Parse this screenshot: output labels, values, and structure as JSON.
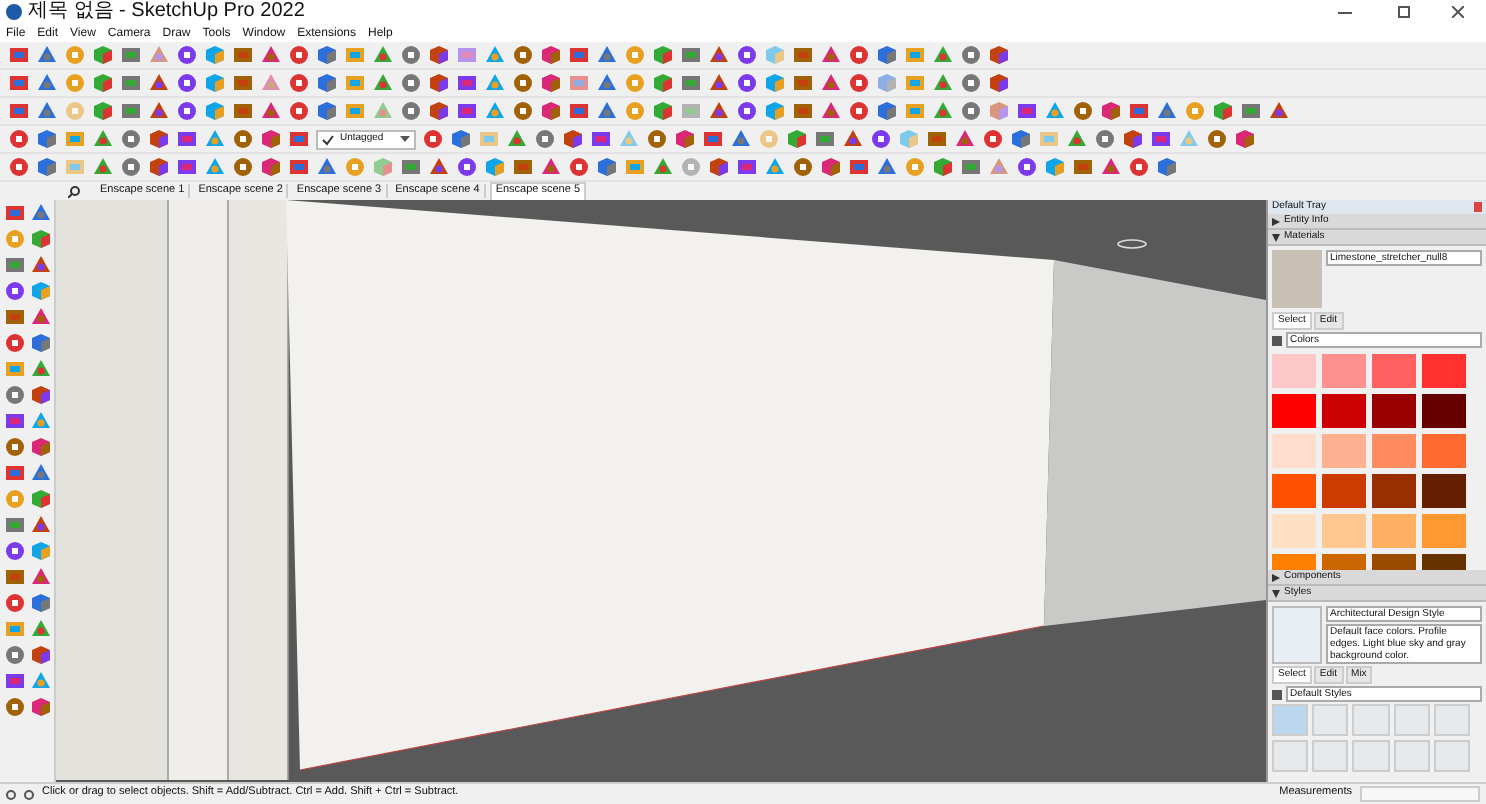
{
  "window": {
    "title": "제목 없음 - SketchUp Pro 2022"
  },
  "menu": [
    "File",
    "Edit",
    "View",
    "Camera",
    "Draw",
    "Tools",
    "Window",
    "Extensions",
    "Help"
  ],
  "tag_dropdown": {
    "value": "Untagged"
  },
  "scene_tabs": [
    {
      "label": "Enscape scene 1",
      "selected": false
    },
    {
      "label": "Enscape scene 2",
      "selected": false
    },
    {
      "label": "Enscape scene 3",
      "selected": false
    },
    {
      "label": "Enscape scene 4",
      "selected": false
    },
    {
      "label": "Enscape scene 5",
      "selected": true
    }
  ],
  "tray": {
    "title": "Default Tray",
    "panels": [
      {
        "kind": "collapsed",
        "title": "Entity Info"
      },
      {
        "kind": "materials",
        "title": "Materials",
        "material_name": "Limestone_stretcher_null8",
        "tabs": [
          {
            "label": "Select",
            "selected": true
          },
          {
            "label": "Edit",
            "selected": false
          }
        ],
        "library": "Colors",
        "swatches": [
          {
            "color": "#ffc8c8"
          },
          {
            "color": "#ff9090"
          },
          {
            "color": "#ff6060"
          },
          {
            "color": "#ff3030"
          },
          {
            "color": "#ff0000"
          },
          {
            "color": "#cc0000"
          },
          {
            "color": "#990000"
          },
          {
            "color": "#660000"
          },
          {
            "color": "#ffdccc"
          },
          {
            "color": "#ffb090"
          },
          {
            "color": "#ff8c60"
          },
          {
            "color": "#ff6a30"
          },
          {
            "color": "#ff5000"
          },
          {
            "color": "#cc3c00"
          },
          {
            "color": "#992e00"
          },
          {
            "color": "#661e00"
          },
          {
            "color": "#ffe0c4"
          },
          {
            "color": "#ffc890"
          },
          {
            "color": "#ffb060"
          },
          {
            "color": "#ff9830"
          },
          {
            "color": "#ff8000"
          },
          {
            "color": "#cc6600"
          },
          {
            "color": "#994c00"
          },
          {
            "color": "#663300"
          }
        ]
      },
      {
        "kind": "collapsed",
        "title": "Components"
      },
      {
        "kind": "styles",
        "title": "Styles",
        "style_name": "Architectural Design Style",
        "description": "Default face colors. Profile edges. Light blue sky and gray background color.",
        "tabs": [
          {
            "label": "Select",
            "selected": true
          },
          {
            "label": "Edit",
            "selected": false
          },
          {
            "label": "Mix",
            "selected": false
          }
        ],
        "library": "Default Styles"
      }
    ]
  },
  "status_bar": {
    "message": "Click or drag to select objects. Shift = Add/Subtract. Ctrl = Add. Shift + Ctrl = Subtract.",
    "measurements_label": "Measurements"
  }
}
